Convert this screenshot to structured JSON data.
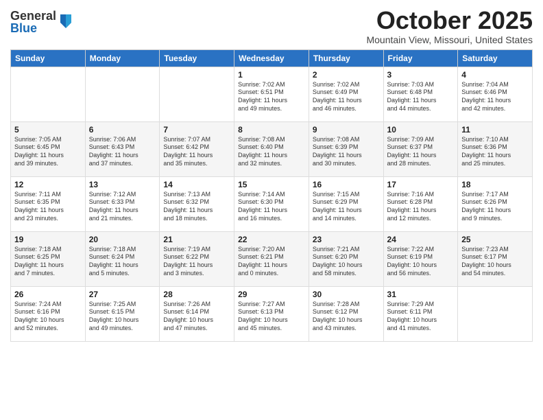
{
  "logo": {
    "general": "General",
    "blue": "Blue"
  },
  "header": {
    "month": "October 2025",
    "location": "Mountain View, Missouri, United States"
  },
  "days_of_week": [
    "Sunday",
    "Monday",
    "Tuesday",
    "Wednesday",
    "Thursday",
    "Friday",
    "Saturday"
  ],
  "weeks": [
    [
      {
        "day": "",
        "info": ""
      },
      {
        "day": "",
        "info": ""
      },
      {
        "day": "",
        "info": ""
      },
      {
        "day": "1",
        "info": "Sunrise: 7:02 AM\nSunset: 6:51 PM\nDaylight: 11 hours\nand 49 minutes."
      },
      {
        "day": "2",
        "info": "Sunrise: 7:02 AM\nSunset: 6:49 PM\nDaylight: 11 hours\nand 46 minutes."
      },
      {
        "day": "3",
        "info": "Sunrise: 7:03 AM\nSunset: 6:48 PM\nDaylight: 11 hours\nand 44 minutes."
      },
      {
        "day": "4",
        "info": "Sunrise: 7:04 AM\nSunset: 6:46 PM\nDaylight: 11 hours\nand 42 minutes."
      }
    ],
    [
      {
        "day": "5",
        "info": "Sunrise: 7:05 AM\nSunset: 6:45 PM\nDaylight: 11 hours\nand 39 minutes."
      },
      {
        "day": "6",
        "info": "Sunrise: 7:06 AM\nSunset: 6:43 PM\nDaylight: 11 hours\nand 37 minutes."
      },
      {
        "day": "7",
        "info": "Sunrise: 7:07 AM\nSunset: 6:42 PM\nDaylight: 11 hours\nand 35 minutes."
      },
      {
        "day": "8",
        "info": "Sunrise: 7:08 AM\nSunset: 6:40 PM\nDaylight: 11 hours\nand 32 minutes."
      },
      {
        "day": "9",
        "info": "Sunrise: 7:08 AM\nSunset: 6:39 PM\nDaylight: 11 hours\nand 30 minutes."
      },
      {
        "day": "10",
        "info": "Sunrise: 7:09 AM\nSunset: 6:37 PM\nDaylight: 11 hours\nand 28 minutes."
      },
      {
        "day": "11",
        "info": "Sunrise: 7:10 AM\nSunset: 6:36 PM\nDaylight: 11 hours\nand 25 minutes."
      }
    ],
    [
      {
        "day": "12",
        "info": "Sunrise: 7:11 AM\nSunset: 6:35 PM\nDaylight: 11 hours\nand 23 minutes."
      },
      {
        "day": "13",
        "info": "Sunrise: 7:12 AM\nSunset: 6:33 PM\nDaylight: 11 hours\nand 21 minutes."
      },
      {
        "day": "14",
        "info": "Sunrise: 7:13 AM\nSunset: 6:32 PM\nDaylight: 11 hours\nand 18 minutes."
      },
      {
        "day": "15",
        "info": "Sunrise: 7:14 AM\nSunset: 6:30 PM\nDaylight: 11 hours\nand 16 minutes."
      },
      {
        "day": "16",
        "info": "Sunrise: 7:15 AM\nSunset: 6:29 PM\nDaylight: 11 hours\nand 14 minutes."
      },
      {
        "day": "17",
        "info": "Sunrise: 7:16 AM\nSunset: 6:28 PM\nDaylight: 11 hours\nand 12 minutes."
      },
      {
        "day": "18",
        "info": "Sunrise: 7:17 AM\nSunset: 6:26 PM\nDaylight: 11 hours\nand 9 minutes."
      }
    ],
    [
      {
        "day": "19",
        "info": "Sunrise: 7:18 AM\nSunset: 6:25 PM\nDaylight: 11 hours\nand 7 minutes."
      },
      {
        "day": "20",
        "info": "Sunrise: 7:18 AM\nSunset: 6:24 PM\nDaylight: 11 hours\nand 5 minutes."
      },
      {
        "day": "21",
        "info": "Sunrise: 7:19 AM\nSunset: 6:22 PM\nDaylight: 11 hours\nand 3 minutes."
      },
      {
        "day": "22",
        "info": "Sunrise: 7:20 AM\nSunset: 6:21 PM\nDaylight: 11 hours\nand 0 minutes."
      },
      {
        "day": "23",
        "info": "Sunrise: 7:21 AM\nSunset: 6:20 PM\nDaylight: 10 hours\nand 58 minutes."
      },
      {
        "day": "24",
        "info": "Sunrise: 7:22 AM\nSunset: 6:19 PM\nDaylight: 10 hours\nand 56 minutes."
      },
      {
        "day": "25",
        "info": "Sunrise: 7:23 AM\nSunset: 6:17 PM\nDaylight: 10 hours\nand 54 minutes."
      }
    ],
    [
      {
        "day": "26",
        "info": "Sunrise: 7:24 AM\nSunset: 6:16 PM\nDaylight: 10 hours\nand 52 minutes."
      },
      {
        "day": "27",
        "info": "Sunrise: 7:25 AM\nSunset: 6:15 PM\nDaylight: 10 hours\nand 49 minutes."
      },
      {
        "day": "28",
        "info": "Sunrise: 7:26 AM\nSunset: 6:14 PM\nDaylight: 10 hours\nand 47 minutes."
      },
      {
        "day": "29",
        "info": "Sunrise: 7:27 AM\nSunset: 6:13 PM\nDaylight: 10 hours\nand 45 minutes."
      },
      {
        "day": "30",
        "info": "Sunrise: 7:28 AM\nSunset: 6:12 PM\nDaylight: 10 hours\nand 43 minutes."
      },
      {
        "day": "31",
        "info": "Sunrise: 7:29 AM\nSunset: 6:11 PM\nDaylight: 10 hours\nand 41 minutes."
      },
      {
        "day": "",
        "info": ""
      }
    ]
  ]
}
